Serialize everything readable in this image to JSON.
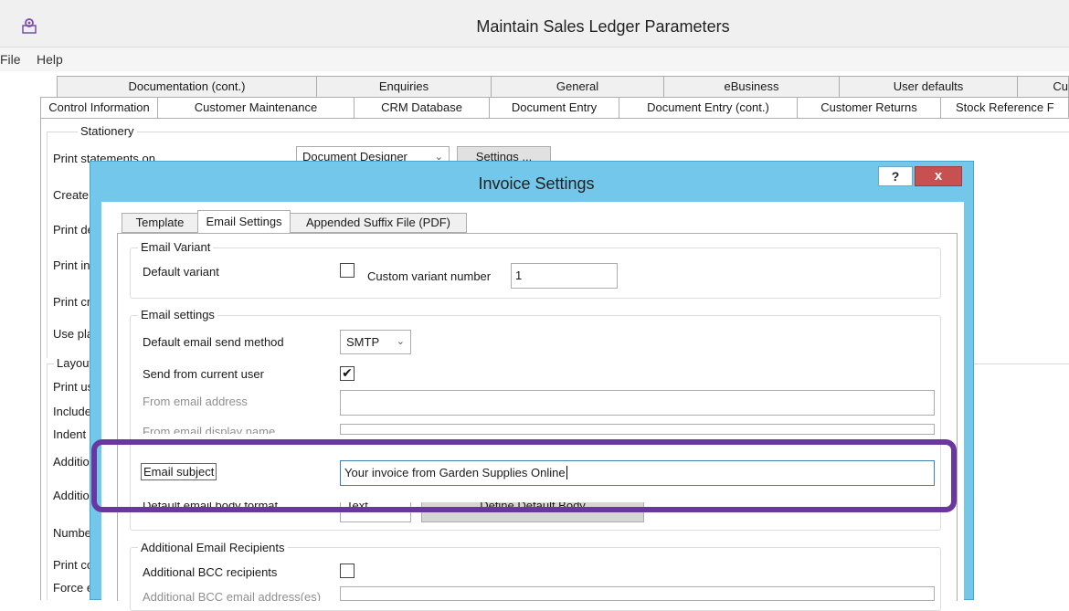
{
  "main_window": {
    "title": "Maintain Sales Ledger Parameters",
    "icon": "settings-gear-icon",
    "menu": [
      "File",
      "Help"
    ],
    "tabs_row1": [
      "Documentation (cont.)",
      "Enquiries",
      "General",
      "eBusiness",
      "User defaults",
      "Cu"
    ],
    "tabs_row2": [
      "Control Information",
      "Customer Maintenance",
      "CRM Database",
      "Document Entry",
      "Document Entry (cont.)",
      "Customer Returns",
      "Stock Reference F"
    ],
    "stationery": {
      "group_title": "Stationery",
      "print_statements_label": "Print statements on",
      "print_statements_value": "Document Designer",
      "settings_button": "Settings ...",
      "labels": [
        "Create c",
        "Print del",
        "Print inv",
        "Print cre",
        "Use plai"
      ]
    },
    "layout": {
      "group_title": "Layout /",
      "labels": [
        "Print usi",
        "Include",
        "Indent",
        "Additio",
        "Additio",
        "Number",
        "Print cor",
        "Force er"
      ]
    }
  },
  "dialog": {
    "title": "Invoice Settings",
    "help_label": "?",
    "close_label": "x",
    "tabs": [
      "Template",
      "Email Settings",
      "Appended Suffix File (PDF)"
    ],
    "active_tab": "Email Settings",
    "email_variant": {
      "group_title": "Email Variant",
      "default_variant_label": "Default variant",
      "default_variant_checked": false,
      "custom_variant_label": "Custom variant number",
      "custom_variant_value": "1"
    },
    "email_settings": {
      "group_title": "Email settings",
      "send_method_label": "Default email send method",
      "send_method_value": "SMTP",
      "send_from_user_label": "Send from current user",
      "send_from_user_checked": "✔",
      "from_address_label": "From email address",
      "from_address_value": "",
      "from_display_label": "From email display name",
      "from_display_value": "",
      "email_subject_label": "Email subject",
      "email_subject_value": "Your invoice from Garden Supplies Online",
      "default_body_label": "Default email body format",
      "default_body_value": "Text",
      "default_body_button": "Define Default Body"
    },
    "recipients": {
      "group_title": "Additional Email Recipients",
      "bcc_label": "Additional BCC recipients",
      "bcc_checked": false,
      "bcc_address_label": "Additional BCC email address(es)",
      "bcc_address_value": ""
    }
  },
  "colors": {
    "dialog_frame": "#72c7ea",
    "close_button": "#c75050",
    "highlight": "#6a36a0"
  }
}
